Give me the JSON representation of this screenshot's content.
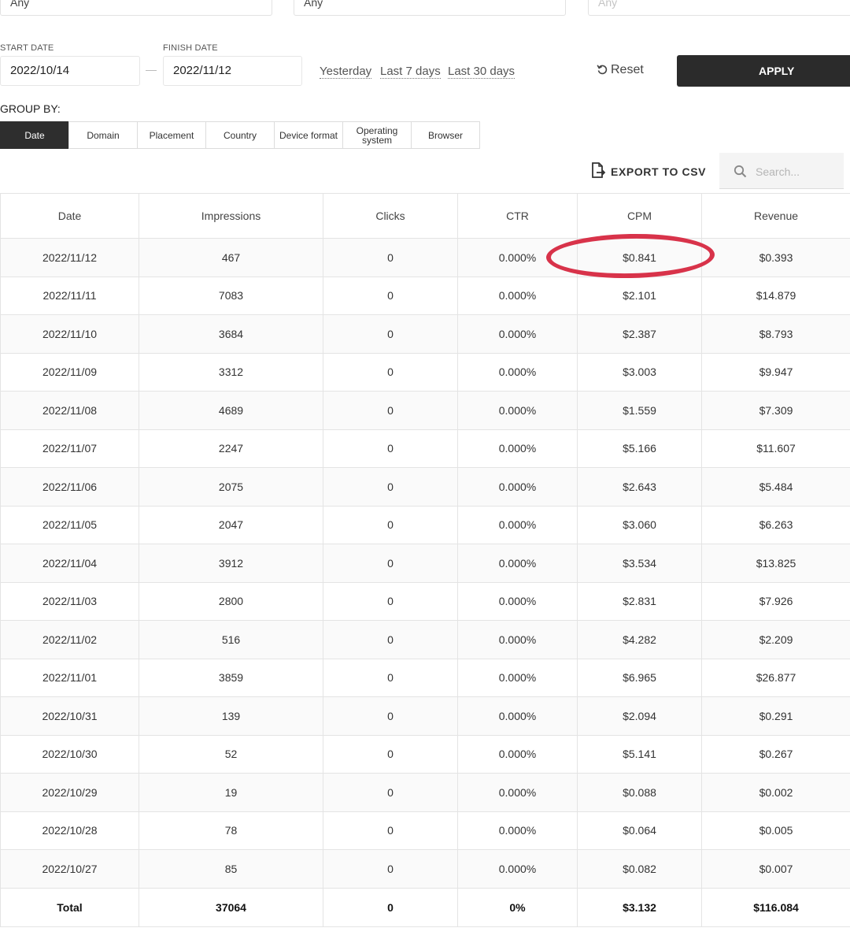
{
  "filters": {
    "top_selects": [
      {
        "value": "Any",
        "muted": false
      },
      {
        "value": "Any",
        "muted": false
      },
      {
        "value": "Any",
        "muted": true
      }
    ],
    "start_date_label": "START DATE",
    "start_date": "2022/10/14",
    "finish_date_label": "FINISH DATE",
    "finish_date": "2022/11/12",
    "quick_ranges": [
      "Yesterday",
      "Last 7 days",
      "Last 30 days"
    ],
    "reset_label": "Reset",
    "apply_label": "APPLY"
  },
  "group_by": {
    "label": "GROUP BY:",
    "options": [
      "Date",
      "Domain",
      "Placement",
      "Country",
      "Device format",
      "Operating system",
      "Browser"
    ],
    "active": "Date"
  },
  "toolbar": {
    "export_label": "EXPORT TO CSV",
    "search_placeholder": "Search..."
  },
  "table": {
    "columns": [
      "Date",
      "Impressions",
      "Clicks",
      "CTR",
      "CPM",
      "Revenue"
    ],
    "rows": [
      [
        "2022/11/12",
        "467",
        "0",
        "0.000%",
        "$0.841",
        "$0.393"
      ],
      [
        "2022/11/11",
        "7083",
        "0",
        "0.000%",
        "$2.101",
        "$14.879"
      ],
      [
        "2022/11/10",
        "3684",
        "0",
        "0.000%",
        "$2.387",
        "$8.793"
      ],
      [
        "2022/11/09",
        "3312",
        "0",
        "0.000%",
        "$3.003",
        "$9.947"
      ],
      [
        "2022/11/08",
        "4689",
        "0",
        "0.000%",
        "$1.559",
        "$7.309"
      ],
      [
        "2022/11/07",
        "2247",
        "0",
        "0.000%",
        "$5.166",
        "$11.607"
      ],
      [
        "2022/11/06",
        "2075",
        "0",
        "0.000%",
        "$2.643",
        "$5.484"
      ],
      [
        "2022/11/05",
        "2047",
        "0",
        "0.000%",
        "$3.060",
        "$6.263"
      ],
      [
        "2022/11/04",
        "3912",
        "0",
        "0.000%",
        "$3.534",
        "$13.825"
      ],
      [
        "2022/11/03",
        "2800",
        "0",
        "0.000%",
        "$2.831",
        "$7.926"
      ],
      [
        "2022/11/02",
        "516",
        "0",
        "0.000%",
        "$4.282",
        "$2.209"
      ],
      [
        "2022/11/01",
        "3859",
        "0",
        "0.000%",
        "$6.965",
        "$26.877"
      ],
      [
        "2022/10/31",
        "139",
        "0",
        "0.000%",
        "$2.094",
        "$0.291"
      ],
      [
        "2022/10/30",
        "52",
        "0",
        "0.000%",
        "$5.141",
        "$0.267"
      ],
      [
        "2022/10/29",
        "19",
        "0",
        "0.000%",
        "$0.088",
        "$0.002"
      ],
      [
        "2022/10/28",
        "78",
        "0",
        "0.000%",
        "$0.064",
        "$0.005"
      ],
      [
        "2022/10/27",
        "85",
        "0",
        "0.000%",
        "$0.082",
        "$0.007"
      ]
    ],
    "totals": [
      "Total",
      "37064",
      "0",
      "0%",
      "$3.132",
      "$116.084"
    ]
  },
  "annotation": {
    "color": "#d8334a",
    "target": "$0.841"
  },
  "colors": {
    "apply_bg": "#2b2b2b",
    "active_group_bg": "#2e2e2e"
  }
}
